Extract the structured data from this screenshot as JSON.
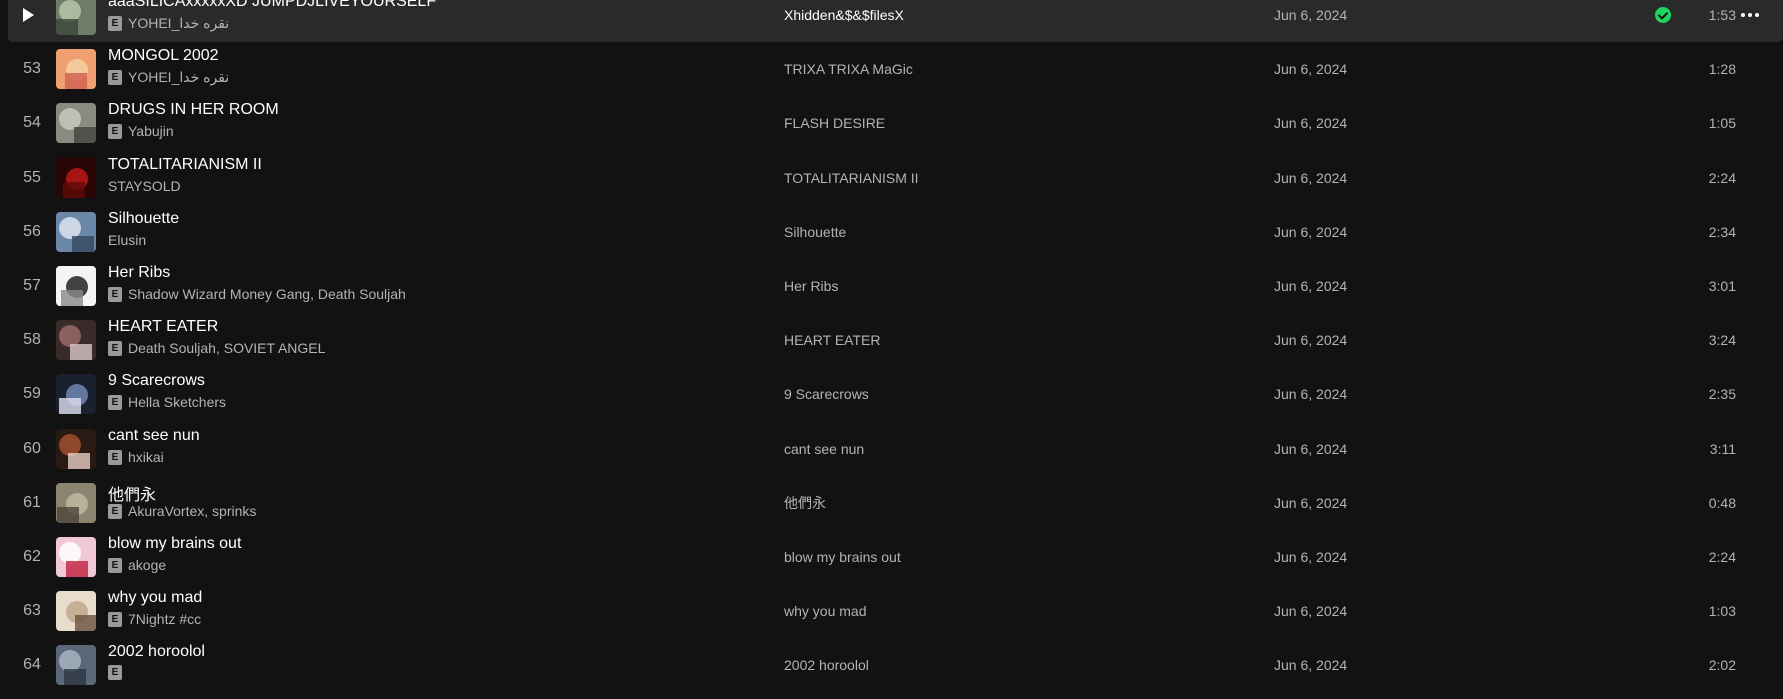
{
  "tracks": [
    {
      "index": "",
      "title": "aaaSILICAxxxxxXD JUMPDJLIVEYOURSELF",
      "artist": "YOHEI_نقره خدا",
      "explicit": true,
      "album": "Xhidden&$&$filesX",
      "date_added": "Jun 6, 2024",
      "duration": "1:53",
      "active": true,
      "saved": true
    },
    {
      "index": "53",
      "title": "MONGOL 2002",
      "artist": "YOHEI_نقره خدا",
      "explicit": true,
      "album": "TRIXA TRIXA MaGic",
      "date_added": "Jun 6, 2024",
      "duration": "1:28"
    },
    {
      "index": "54",
      "title": "DRUGS IN HER ROOM",
      "artist": "Yabujin",
      "explicit": true,
      "album": "FLASH DESIRE",
      "date_added": "Jun 6, 2024",
      "duration": "1:05"
    },
    {
      "index": "55",
      "title": "TOTALITARIANISM II",
      "artist": "STAYSOLD",
      "explicit": false,
      "album": "TOTALITARIANISM II",
      "date_added": "Jun 6, 2024",
      "duration": "2:24"
    },
    {
      "index": "56",
      "title": "Silhouette",
      "artist": "Elusin",
      "explicit": false,
      "album": "Silhouette",
      "date_added": "Jun 6, 2024",
      "duration": "2:34"
    },
    {
      "index": "57",
      "title": "Her Ribs",
      "artist": "Shadow Wizard Money Gang, Death Souljah",
      "explicit": true,
      "album": "Her Ribs",
      "date_added": "Jun 6, 2024",
      "duration": "3:01"
    },
    {
      "index": "58",
      "title": "HEART EATER",
      "artist": "Death Souljah, SOVIET ANGEL",
      "explicit": true,
      "album": "HEART EATER",
      "date_added": "Jun 6, 2024",
      "duration": "3:24"
    },
    {
      "index": "59",
      "title": "9 Scarecrows",
      "artist": "Hella Sketchers",
      "explicit": true,
      "album": "9 Scarecrows",
      "date_added": "Jun 6, 2024",
      "duration": "2:35"
    },
    {
      "index": "60",
      "title": "cant see nun",
      "artist": "hxikai",
      "explicit": true,
      "album": "cant see nun",
      "date_added": "Jun 6, 2024",
      "duration": "3:11"
    },
    {
      "index": "61",
      "title": "他們永",
      "artist": "AkuraVortex, sprinks",
      "explicit": true,
      "album": "他們永",
      "date_added": "Jun 6, 2024",
      "duration": "0:48"
    },
    {
      "index": "62",
      "title": "blow my brains out",
      "artist": "akoge",
      "explicit": true,
      "album": "blow my brains out",
      "date_added": "Jun 6, 2024",
      "duration": "2:24"
    },
    {
      "index": "63",
      "title": "why you mad",
      "artist": "7Nightz #cc",
      "explicit": true,
      "album": "why you mad",
      "date_added": "Jun 6, 2024",
      "duration": "1:03"
    },
    {
      "index": "64",
      "title": "2002 horoolol",
      "artist": "",
      "explicit": true,
      "album": "2002 horoolol",
      "date_added": "Jun 6, 2024",
      "duration": "2:02"
    }
  ],
  "colors": {
    "background": "#121212",
    "active_row": "#2a2a2a",
    "accent_green": "#1ed760",
    "text_primary": "#ffffff",
    "text_secondary": "#b3b3b3"
  },
  "icons": {
    "play": "play-icon",
    "saved": "check-circle-icon",
    "more": "more-horizontal-icon",
    "explicit_badge": "E"
  }
}
